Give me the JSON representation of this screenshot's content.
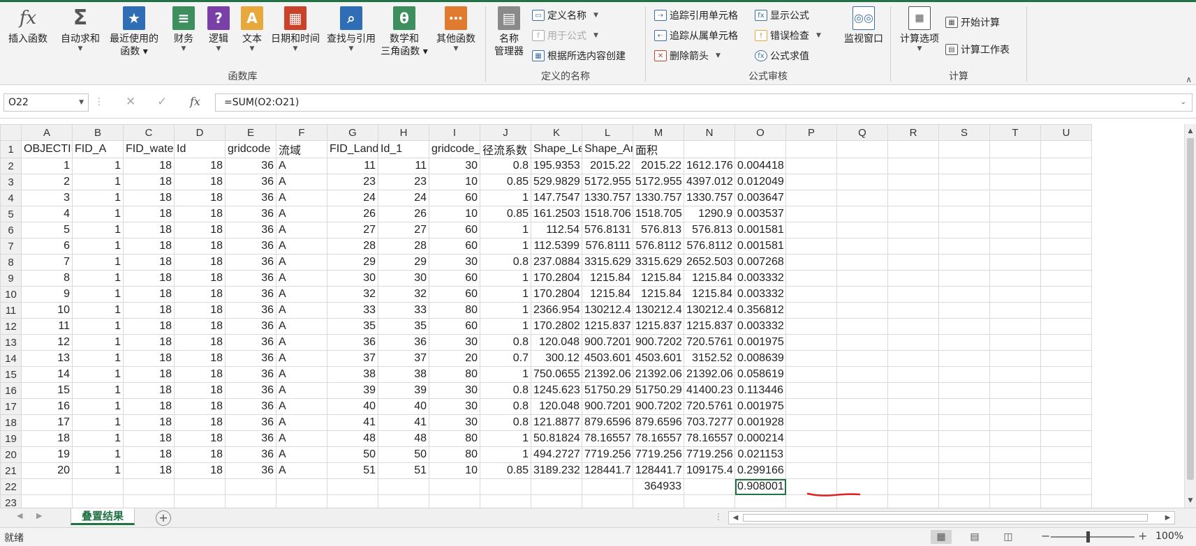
{
  "ribbon": {
    "library": {
      "label": "函数库",
      "buttons": [
        {
          "id": "insert-function",
          "line1": "插入函数",
          "line2": "",
          "icon": "fx-icon",
          "color": "#555555"
        },
        {
          "id": "autosum",
          "line1": "自动求和",
          "line2": "",
          "icon": "sigma-icon",
          "color": "#555555"
        },
        {
          "id": "recently-used",
          "line1": "最近使用的",
          "line2": "函数",
          "icon": "star-book-icon",
          "color": "#2f6db5"
        },
        {
          "id": "financial",
          "line1": "财务",
          "line2": "",
          "icon": "coins-book-icon",
          "color": "#3e8f5e"
        },
        {
          "id": "logical",
          "line1": "逻辑",
          "line2": "",
          "icon": "question-book-icon",
          "color": "#7b3fa8"
        },
        {
          "id": "text",
          "line1": "文本",
          "line2": "",
          "icon": "text-book-icon",
          "color": "#e8a93c"
        },
        {
          "id": "date-time",
          "line1": "日期和时间",
          "line2": "",
          "icon": "calendar-book-icon",
          "color": "#c9432a"
        },
        {
          "id": "lookup-reference",
          "line1": "查找与引用",
          "line2": "",
          "icon": "search-book-icon",
          "color": "#2f6db5"
        },
        {
          "id": "math-trig",
          "line1": "数学和",
          "line2": "三角函数",
          "icon": "theta-book-icon",
          "color": "#3e8f5e"
        },
        {
          "id": "more-functions",
          "line1": "其他函数",
          "line2": "",
          "icon": "more-book-icon",
          "color": "#e07a2f"
        }
      ]
    },
    "names": {
      "label": "定义的名称",
      "name_manager_line1": "名称",
      "name_manager_line2": "管理器",
      "define_name": "定义名称",
      "use_in_formula": "用于公式",
      "create_from_selection": "根据所选内容创建"
    },
    "auditing": {
      "label": "公式审核",
      "trace_precedents": "追踪引用单元格",
      "trace_dependents": "追踪从属单元格",
      "remove_arrows": "删除箭头",
      "show_formulas": "显示公式",
      "error_checking": "错误检查",
      "evaluate_formula": "公式求值",
      "watch_window": "监视窗口"
    },
    "calculation": {
      "label": "计算",
      "calc_options": "计算选项",
      "calc_now": "开始计算",
      "calc_sheet": "计算工作表"
    }
  },
  "formula_bar": {
    "name_box": "O22",
    "formula": "=SUM(O2:O21)",
    "cancel_symbol": "✕",
    "enter_symbol": "✓",
    "fx_symbol": "fx"
  },
  "sheet": {
    "columns": [
      "A",
      "B",
      "C",
      "D",
      "E",
      "F",
      "G",
      "H",
      "I",
      "J",
      "K",
      "L",
      "M",
      "N",
      "O",
      "P",
      "Q",
      "R",
      "S",
      "T",
      "U"
    ],
    "rows": [
      [
        "OBJECTID",
        "FID_A",
        "FID_water",
        "Id",
        "gridcode",
        "流域",
        "FID_Landu",
        "Id_1",
        "gridcode_",
        "径流系数",
        "Shape_Ler",
        "Shape_Are",
        "面积",
        "",
        "",
        "",
        "",
        "",
        "",
        "",
        ""
      ],
      [
        "1",
        "1",
        "18",
        "18",
        "36",
        "A",
        "11",
        "11",
        "30",
        "0.8",
        "195.9353",
        "2015.22",
        "2015.22",
        "1612.176",
        "0.004418",
        "",
        "",
        "",
        "",
        "",
        ""
      ],
      [
        "2",
        "1",
        "18",
        "18",
        "36",
        "A",
        "23",
        "23",
        "10",
        "0.85",
        "529.9829",
        "5172.955",
        "5172.955",
        "4397.012",
        "0.012049",
        "",
        "",
        "",
        "",
        "",
        ""
      ],
      [
        "3",
        "1",
        "18",
        "18",
        "36",
        "A",
        "24",
        "24",
        "60",
        "1",
        "147.7547",
        "1330.757",
        "1330.757",
        "1330.757",
        "0.003647",
        "",
        "",
        "",
        "",
        "",
        ""
      ],
      [
        "4",
        "1",
        "18",
        "18",
        "36",
        "A",
        "26",
        "26",
        "10",
        "0.85",
        "161.2503",
        "1518.706",
        "1518.705",
        "1290.9",
        "0.003537",
        "",
        "",
        "",
        "",
        "",
        ""
      ],
      [
        "5",
        "1",
        "18",
        "18",
        "36",
        "A",
        "27",
        "27",
        "60",
        "1",
        "112.54",
        "576.8131",
        "576.813",
        "576.813",
        "0.001581",
        "",
        "",
        "",
        "",
        "",
        ""
      ],
      [
        "6",
        "1",
        "18",
        "18",
        "36",
        "A",
        "28",
        "28",
        "60",
        "1",
        "112.5399",
        "576.8111",
        "576.8112",
        "576.8112",
        "0.001581",
        "",
        "",
        "",
        "",
        "",
        ""
      ],
      [
        "7",
        "1",
        "18",
        "18",
        "36",
        "A",
        "29",
        "29",
        "30",
        "0.8",
        "237.0884",
        "3315.629",
        "3315.629",
        "2652.503",
        "0.007268",
        "",
        "",
        "",
        "",
        "",
        ""
      ],
      [
        "8",
        "1",
        "18",
        "18",
        "36",
        "A",
        "30",
        "30",
        "60",
        "1",
        "170.2804",
        "1215.84",
        "1215.84",
        "1215.84",
        "0.003332",
        "",
        "",
        "",
        "",
        "",
        ""
      ],
      [
        "9",
        "1",
        "18",
        "18",
        "36",
        "A",
        "32",
        "32",
        "60",
        "1",
        "170.2804",
        "1215.84",
        "1215.84",
        "1215.84",
        "0.003332",
        "",
        "",
        "",
        "",
        "",
        ""
      ],
      [
        "10",
        "1",
        "18",
        "18",
        "36",
        "A",
        "33",
        "33",
        "80",
        "1",
        "2366.954",
        "130212.4",
        "130212.4",
        "130212.4",
        "0.356812",
        "",
        "",
        "",
        "",
        "",
        ""
      ],
      [
        "11",
        "1",
        "18",
        "18",
        "36",
        "A",
        "35",
        "35",
        "60",
        "1",
        "170.2802",
        "1215.837",
        "1215.837",
        "1215.837",
        "0.003332",
        "",
        "",
        "",
        "",
        "",
        ""
      ],
      [
        "12",
        "1",
        "18",
        "18",
        "36",
        "A",
        "36",
        "36",
        "30",
        "0.8",
        "120.048",
        "900.7201",
        "900.7202",
        "720.5761",
        "0.001975",
        "",
        "",
        "",
        "",
        "",
        ""
      ],
      [
        "13",
        "1",
        "18",
        "18",
        "36",
        "A",
        "37",
        "37",
        "20",
        "0.7",
        "300.12",
        "4503.601",
        "4503.601",
        "3152.52",
        "0.008639",
        "",
        "",
        "",
        "",
        "",
        ""
      ],
      [
        "14",
        "1",
        "18",
        "18",
        "36",
        "A",
        "38",
        "38",
        "80",
        "1",
        "750.0655",
        "21392.06",
        "21392.06",
        "21392.06",
        "0.058619",
        "",
        "",
        "",
        "",
        "",
        ""
      ],
      [
        "15",
        "1",
        "18",
        "18",
        "36",
        "A",
        "39",
        "39",
        "30",
        "0.8",
        "1245.623",
        "51750.29",
        "51750.29",
        "41400.23",
        "0.113446",
        "",
        "",
        "",
        "",
        "",
        ""
      ],
      [
        "16",
        "1",
        "18",
        "18",
        "36",
        "A",
        "40",
        "40",
        "30",
        "0.8",
        "120.048",
        "900.7201",
        "900.7202",
        "720.5761",
        "0.001975",
        "",
        "",
        "",
        "",
        "",
        ""
      ],
      [
        "17",
        "1",
        "18",
        "18",
        "36",
        "A",
        "41",
        "41",
        "30",
        "0.8",
        "121.8877",
        "879.6596",
        "879.6596",
        "703.7277",
        "0.001928",
        "",
        "",
        "",
        "",
        "",
        ""
      ],
      [
        "18",
        "1",
        "18",
        "18",
        "36",
        "A",
        "48",
        "48",
        "80",
        "1",
        "50.81824",
        "78.16557",
        "78.16557",
        "78.16557",
        "0.000214",
        "",
        "",
        "",
        "",
        "",
        ""
      ],
      [
        "19",
        "1",
        "18",
        "18",
        "36",
        "A",
        "50",
        "50",
        "80",
        "1",
        "494.2727",
        "7719.256",
        "7719.256",
        "7719.256",
        "0.021153",
        "",
        "",
        "",
        "",
        "",
        ""
      ],
      [
        "20",
        "1",
        "18",
        "18",
        "36",
        "A",
        "51",
        "51",
        "10",
        "0.85",
        "3189.232",
        "128441.7",
        "128441.7",
        "109175.4",
        "0.299166",
        "",
        "",
        "",
        "",
        "",
        ""
      ],
      [
        "",
        "",
        "",
        "",
        "",
        "",
        "",
        "",
        "",
        "",
        "",
        "",
        "364933",
        "",
        "0.908001",
        "",
        "",
        "",
        "",
        "",
        ""
      ],
      [
        "",
        "",
        "",
        "",
        "",
        "",
        "",
        "",
        "",
        "",
        "",
        "",
        "",
        "",
        "",
        "",
        "",
        "",
        "",
        "",
        ""
      ]
    ],
    "active_row": 22,
    "active_col": "O",
    "annotation_color": "#e02020"
  },
  "tabs": {
    "sheet_name": "叠置结果",
    "add_symbol": "+"
  },
  "status": {
    "text": "就绪",
    "zoom": "100%",
    "zoom_minus": "−",
    "zoom_plus": "+"
  }
}
